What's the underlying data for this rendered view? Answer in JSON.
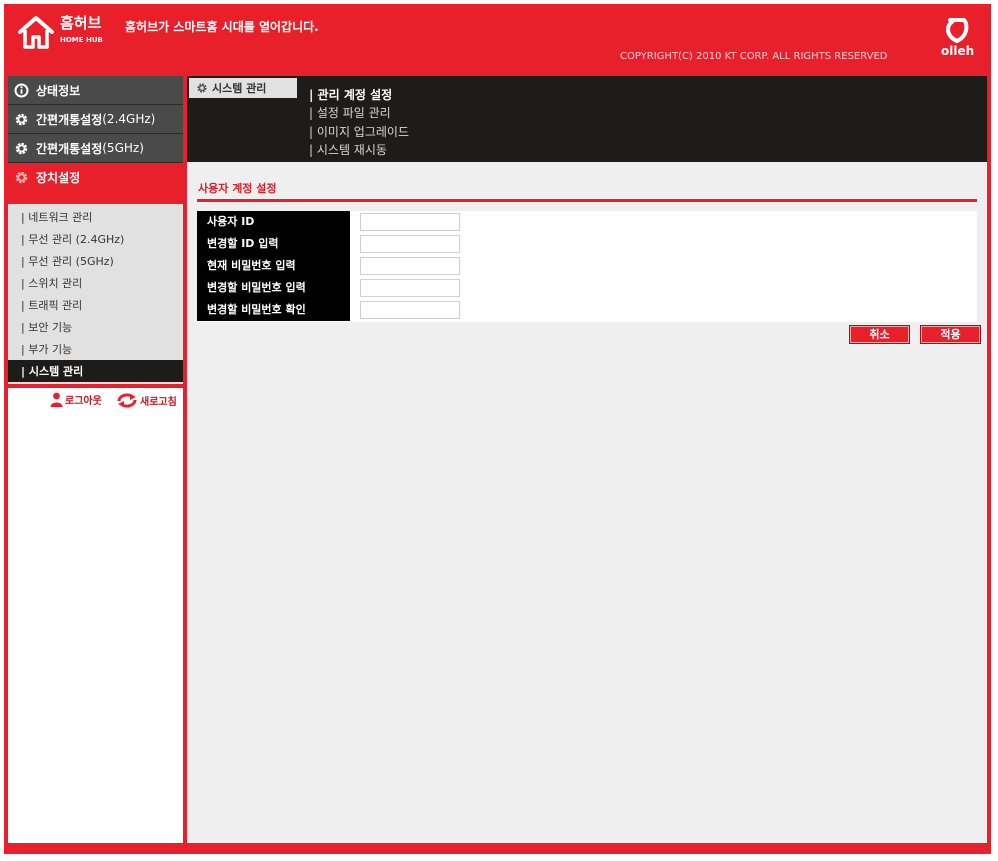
{
  "header": {
    "logo_ko": "홈허브",
    "logo_en": "HOME HUB",
    "slogan": "홈허브가 스마트홈 시대를 열어갑니다.",
    "copyright": "COPYRIGHT(C) 2010 KT CORP. ALL RIGHTS RESERVED",
    "brand": "olleh"
  },
  "left_menu": {
    "main_items": [
      {
        "label": "상태정보",
        "icon": "info-icon"
      },
      {
        "label": "간편개통설정",
        "suffix": " (2.4GHz)",
        "icon": "gear-icon"
      },
      {
        "label": "간편개통설정",
        "suffix": " (5GHz)",
        "icon": "gear-icon"
      },
      {
        "label": "장치설정",
        "icon": "gear-icon",
        "active": true
      }
    ],
    "sub_items": [
      {
        "label": "| 네트워크 관리"
      },
      {
        "label": "| 무선 관리 (2.4GHz)"
      },
      {
        "label": "| 무선 관리 (5GHz)"
      },
      {
        "label": "| 스위치 관리"
      },
      {
        "label": "| 트래픽 관리"
      },
      {
        "label": "| 보안 기능"
      },
      {
        "label": "| 부가 기능"
      },
      {
        "label": "| 시스템 관리",
        "active": true
      }
    ],
    "logout": "로그아웃",
    "refresh": "새로고침"
  },
  "main": {
    "section_tab": "시스템 관리",
    "subnav": [
      {
        "label": "| 관리 계정 설정",
        "active": true
      },
      {
        "label": "| 설정 파일 관리"
      },
      {
        "label": "| 이미지 업그레이드"
      },
      {
        "label": "| 시스템 재시동"
      }
    ],
    "form_title": "사용자 계정 설정",
    "fields": [
      {
        "label": "사용자 ID",
        "value": ""
      },
      {
        "label": "변경할 ID 입력",
        "value": ""
      },
      {
        "label": "현재 비밀번호 입력",
        "value": ""
      },
      {
        "label": "변경할 비밀번호 입력",
        "value": ""
      },
      {
        "label": "변경할 비밀번호 확인",
        "value": ""
      }
    ],
    "cancel_label": "취소",
    "apply_label": "적용"
  },
  "colors": {
    "brand_red": "#e8202b",
    "dark": "#1e1b1b",
    "menu_gray": "#4a4a4a",
    "panel_gray": "#efefef"
  }
}
